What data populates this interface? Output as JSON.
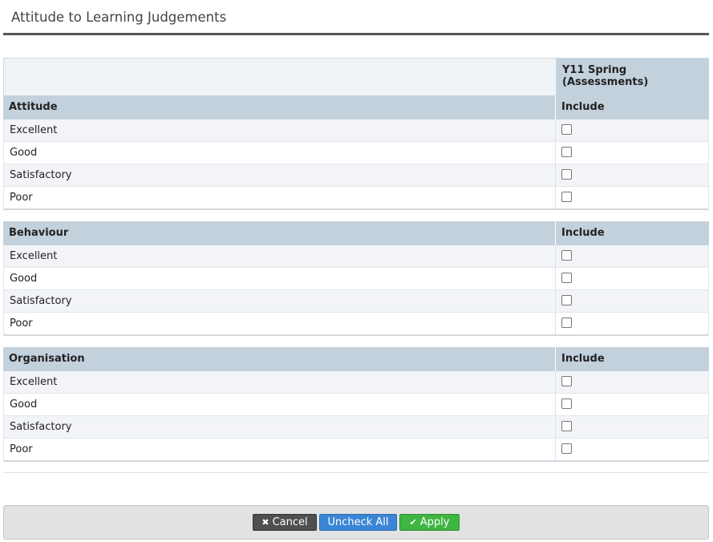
{
  "page": {
    "title": "Attitude to Learning Judgements"
  },
  "table": {
    "column_header": "Y11 Spring\n(Assessments)",
    "groups": [
      {
        "name": "Attitude",
        "include_label": "Include",
        "items": [
          {
            "label": "Excellent",
            "checked": false
          },
          {
            "label": "Good",
            "checked": false
          },
          {
            "label": "Satisfactory",
            "checked": false
          },
          {
            "label": "Poor",
            "checked": false
          }
        ]
      },
      {
        "name": "Behaviour",
        "include_label": "Include",
        "items": [
          {
            "label": "Excellent",
            "checked": false
          },
          {
            "label": "Good",
            "checked": false
          },
          {
            "label": "Satisfactory",
            "checked": false
          },
          {
            "label": "Poor",
            "checked": false
          }
        ]
      },
      {
        "name": "Organisation",
        "include_label": "Include",
        "items": [
          {
            "label": "Excellent",
            "checked": false
          },
          {
            "label": "Good",
            "checked": false
          },
          {
            "label": "Satisfactory",
            "checked": false
          },
          {
            "label": "Poor",
            "checked": false
          }
        ]
      }
    ]
  },
  "footer": {
    "cancel_label": "Cancel",
    "cancel_icon": "close-icon",
    "uncheck_all_label": "Uncheck All",
    "apply_label": "Apply",
    "apply_icon": "checkmark-icon"
  }
}
